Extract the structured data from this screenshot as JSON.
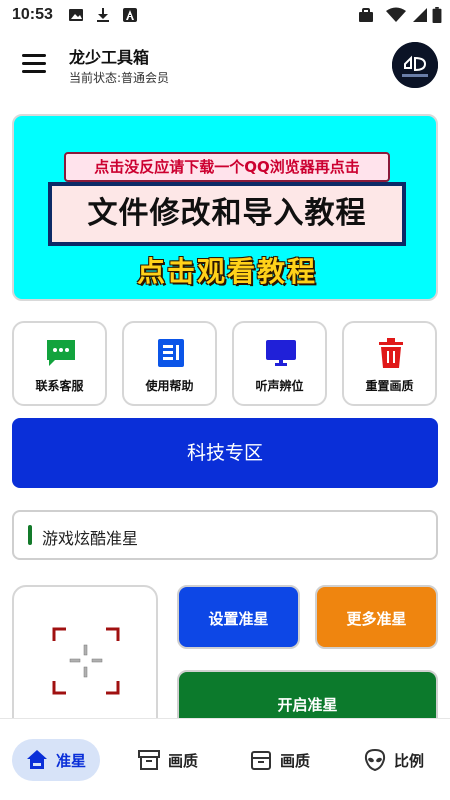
{
  "status_bar": {
    "time": "10:53"
  },
  "header": {
    "title": "龙少工具箱",
    "status": "当前状态:普通会员"
  },
  "banner": {
    "tip": "点击没反应请下载一个QQ浏览器再点击",
    "headline": "文件修改和导入教程",
    "cta": "点击观看教程"
  },
  "quick_actions": [
    {
      "label": "联系客服",
      "icon": "chat-icon",
      "color": "#12a33d"
    },
    {
      "label": "使用帮助",
      "icon": "document-icon",
      "color": "#0b55e8"
    },
    {
      "label": "听声辨位",
      "icon": "monitor-icon",
      "color": "#2020d8"
    },
    {
      "label": "重置画质",
      "icon": "trash-icon",
      "color": "#e01818"
    }
  ],
  "tech_zone": {
    "label": "科技专区"
  },
  "game_field": {
    "value": "游戏炫酷准星"
  },
  "crosshair": {
    "set_label": "设置准星",
    "more_label": "更多准星",
    "open_label": "开启准星"
  },
  "bottom_nav": [
    {
      "label": "准星",
      "icon": "home-icon",
      "active": true
    },
    {
      "label": "画质",
      "icon": "archive-icon",
      "active": false
    },
    {
      "label": "画质",
      "icon": "box-icon",
      "active": false
    },
    {
      "label": "比例",
      "icon": "alien-icon",
      "active": false
    }
  ],
  "colors": {
    "primary_blue": "#0a2fd8",
    "banner_cyan": "#00ffff",
    "orange": "#ef850f",
    "green": "#0c7a2c"
  }
}
